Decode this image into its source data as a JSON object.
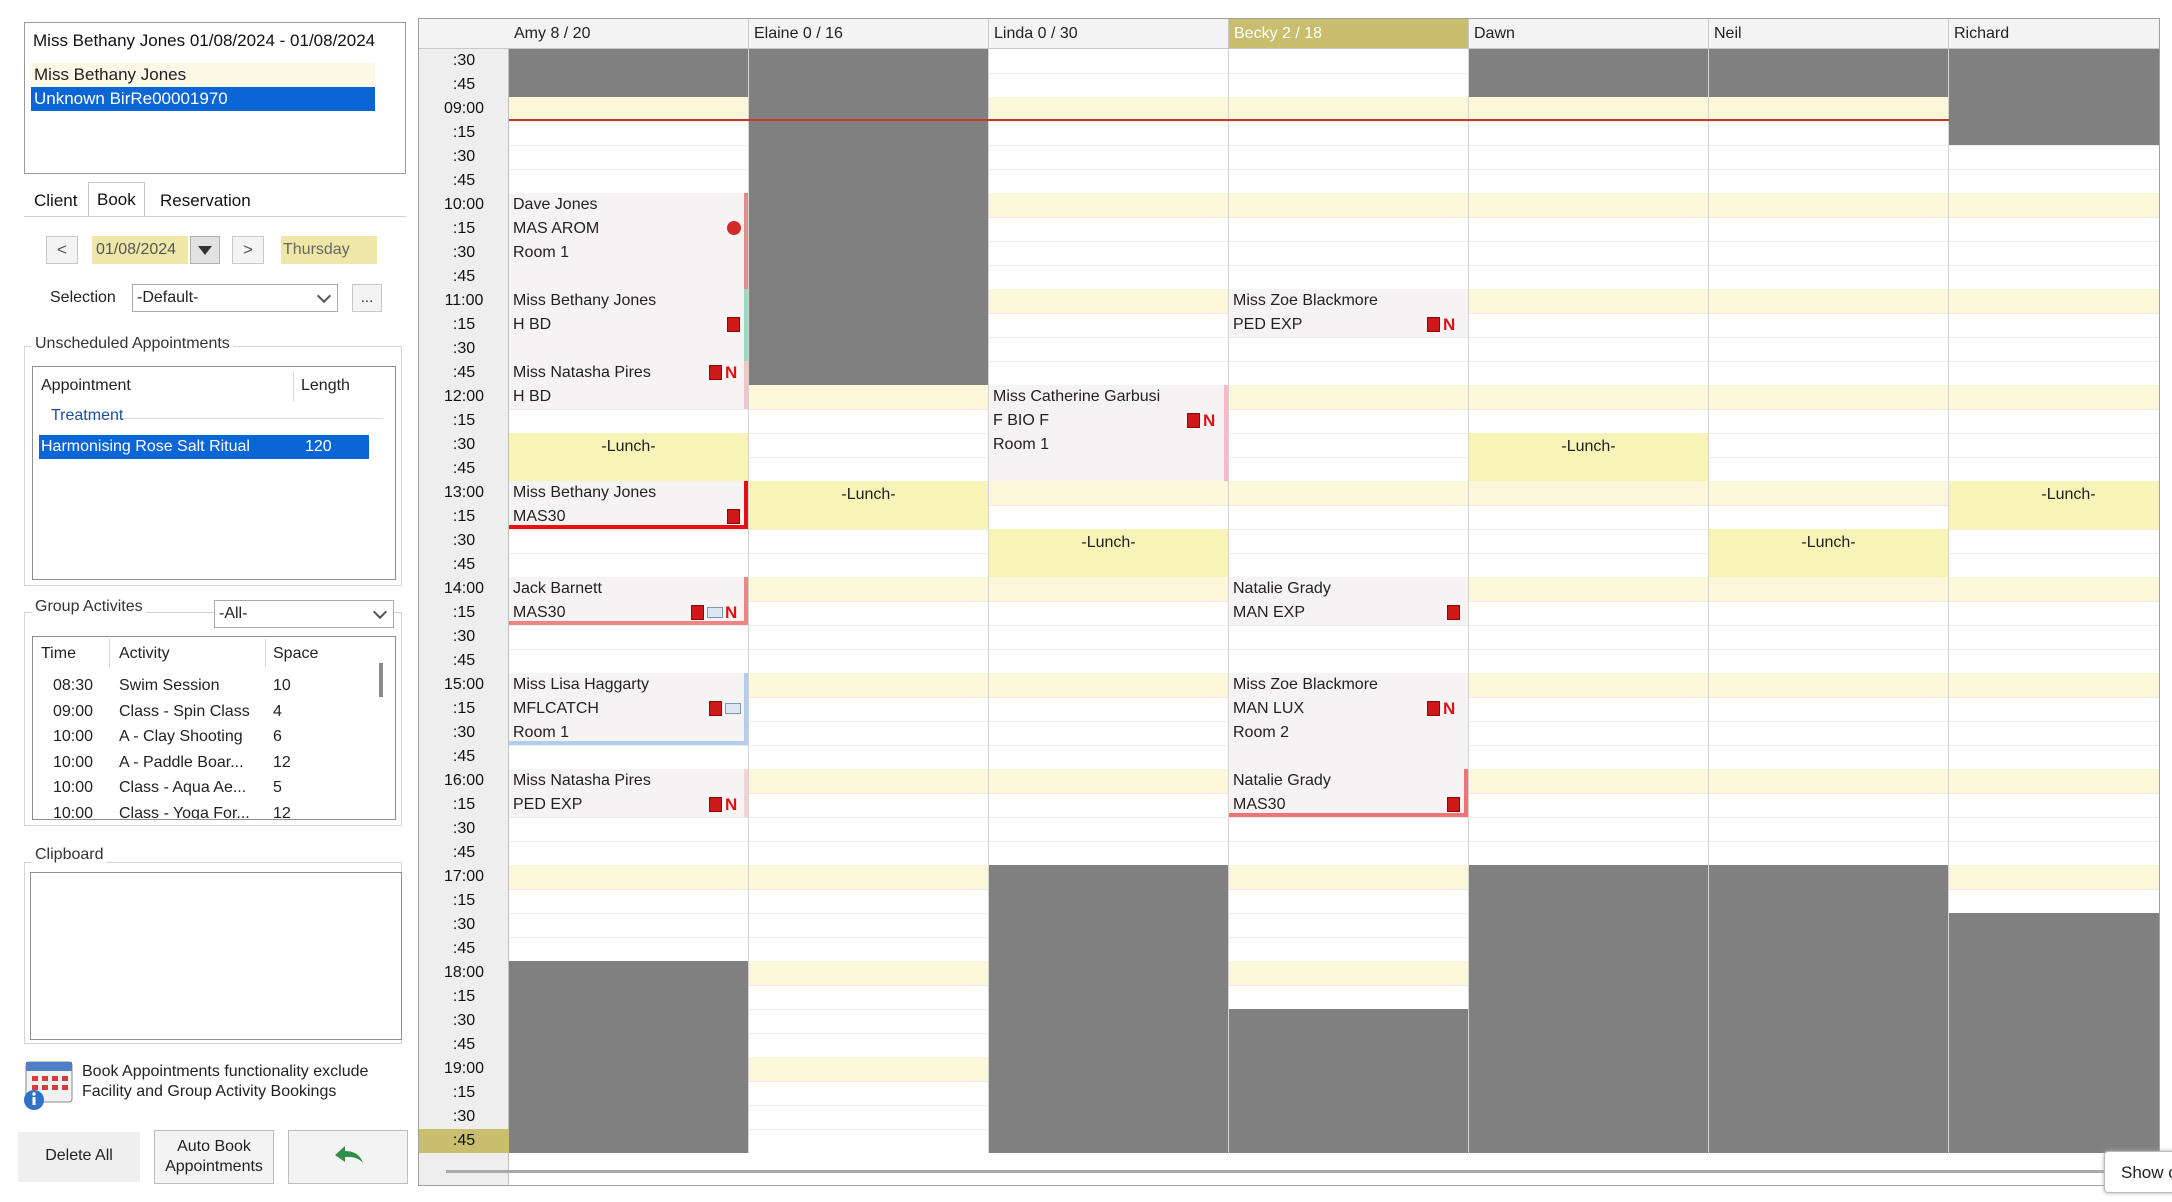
{
  "client_box": {
    "header": "Miss Bethany Jones 01/08/2024 - 01/08/2024",
    "rows": [
      "Miss Bethany Jones",
      "Unknown BirRe00001970"
    ]
  },
  "tabs": [
    "Client",
    "Book",
    "Reservation"
  ],
  "date_nav": {
    "prev": "<",
    "date": "01/08/2024",
    "next": ">",
    "day": "Thursday"
  },
  "selection": {
    "label": "Selection",
    "value": "-Default-",
    "more": "..."
  },
  "unscheduled": {
    "title": "Unscheduled Appointments",
    "col_appointment": "Appointment",
    "col_length": "Length",
    "group": "Treatment",
    "rows": [
      {
        "name": "Harmonising Rose Salt Ritual",
        "length": "120"
      }
    ]
  },
  "group_activities": {
    "title": "Group Activites",
    "filter": "-All-",
    "col_time": "Time",
    "col_activity": "Activity",
    "col_space": "Space",
    "rows": [
      {
        "time": "08:30",
        "activity": "Swim Session",
        "space": "10"
      },
      {
        "time": "09:00",
        "activity": "Class - Spin Class",
        "space": "4"
      },
      {
        "time": "10:00",
        "activity": "A - Clay Shooting",
        "space": "6"
      },
      {
        "time": "10:00",
        "activity": "A - Paddle Boar...",
        "space": "12"
      },
      {
        "time": "10:00",
        "activity": "Class - Aqua Ae...",
        "space": "5"
      },
      {
        "time": "10:00",
        "activity": "Class - Yoga For...",
        "space": "12"
      }
    ]
  },
  "clipboard": {
    "title": "Clipboard"
  },
  "info_note": "Book Appointments functionality exclude Facility and Group Activity Bookings",
  "buttons": {
    "delete_all": "Delete All",
    "auto_book": "Auto Book Appointments"
  },
  "show_button": "Show c",
  "colors": {
    "selected": "#0a66d6",
    "lunch": "#f8f3b7",
    "unavailable": "#808080",
    "hour_band": "#fbf7d8",
    "active_header": "#c9bd6e"
  },
  "time_labels": [
    ":30",
    ":45",
    "09:00",
    ":15",
    ":30",
    ":45",
    "10:00",
    ":15",
    ":30",
    ":45",
    "11:00",
    ":15",
    ":30",
    ":45",
    "12:00",
    ":15",
    ":30",
    ":45",
    "13:00",
    ":15",
    ":30",
    ":45",
    "14:00",
    ":15",
    ":30",
    ":45",
    "15:00",
    ":15",
    ":30",
    ":45",
    "16:00",
    ":15",
    ":30",
    ":45",
    "17:00",
    ":15",
    ":30",
    ":45",
    "18:00",
    ":15",
    ":30",
    ":45",
    "19:00",
    ":15",
    ":30",
    ":45"
  ],
  "staff": [
    {
      "header": "Amy 8 / 20"
    },
    {
      "header": "Elaine 0 / 16"
    },
    {
      "header": "Linda 0 / 30"
    },
    {
      "header": "Becky 2 / 18"
    },
    {
      "header": "Dawn"
    },
    {
      "header": "Neil"
    },
    {
      "header": "Richard"
    }
  ],
  "lunch_label": "-Lunch-",
  "appointments": [
    {
      "staff": 0,
      "lines": [
        "Dave Jones",
        "MAS AROM",
        "Room 1"
      ]
    },
    {
      "staff": 0,
      "lines": [
        "Miss Bethany Jones",
        "H BD"
      ]
    },
    {
      "staff": 0,
      "lines": [
        "Miss Natasha Pires",
        "H BD"
      ]
    },
    {
      "staff": 0,
      "lines": [
        "Miss Bethany Jones",
        "MAS30"
      ]
    },
    {
      "staff": 0,
      "lines": [
        "Jack Barnett",
        "MAS30"
      ]
    },
    {
      "staff": 0,
      "lines": [
        "Miss Lisa Haggarty",
        "MFLCATCH",
        "Room 1"
      ]
    },
    {
      "staff": 0,
      "lines": [
        "Miss Natasha Pires",
        "PED EXP"
      ]
    },
    {
      "staff": 2,
      "lines": [
        "Miss Catherine Garbusi",
        "F BIO F",
        "Room 1"
      ]
    },
    {
      "staff": 3,
      "lines": [
        "Miss Zoe Blackmore",
        "PED EXP"
      ]
    },
    {
      "staff": 3,
      "lines": [
        "Natalie Grady",
        "MAN EXP"
      ]
    },
    {
      "staff": 3,
      "lines": [
        "Miss Zoe Blackmore",
        "MAN LUX",
        "Room 2"
      ]
    },
    {
      "staff": 3,
      "lines": [
        "Natalie Grady",
        "MAS30"
      ]
    }
  ]
}
